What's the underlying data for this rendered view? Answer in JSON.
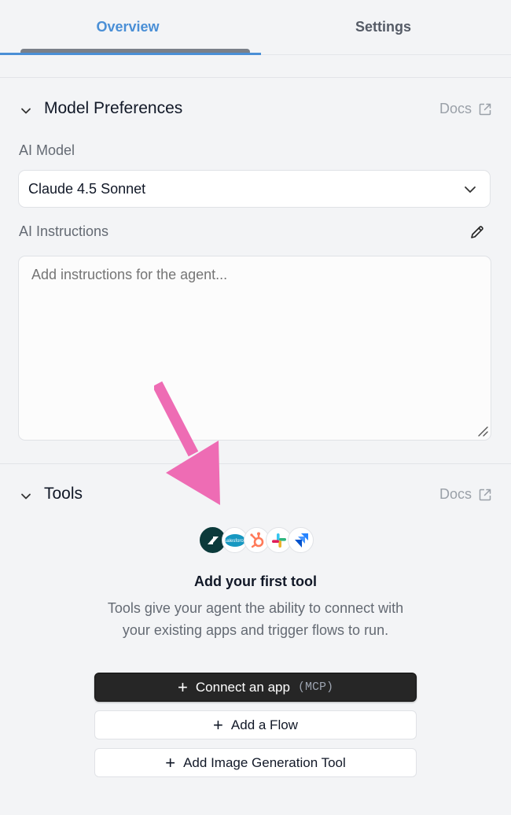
{
  "tabs": {
    "overview": "Overview",
    "settings": "Settings"
  },
  "model_section": {
    "title": "Model Preferences",
    "docs_label": "Docs",
    "ai_model_label": "AI Model",
    "ai_model_value": "Claude 4.5 Sonnet",
    "ai_instructions_label": "AI Instructions",
    "instructions_placeholder": "Add instructions for the agent..."
  },
  "tools_section": {
    "title": "Tools",
    "docs_label": "Docs",
    "logos": [
      "zendesk-logo",
      "salesforce-logo",
      "hubspot-logo",
      "slack-logo",
      "jira-logo"
    ],
    "salesforce_wordmark": "salesforce",
    "empty_title": "Add your first tool",
    "empty_description": "Tools give your agent the ability to connect with your existing apps and trigger flows to run.",
    "connect_app_label": "Connect an app",
    "connect_app_badge": "(MCP)",
    "add_flow_label": "Add a Flow",
    "add_image_tool_label": "Add Image Generation Tool"
  },
  "colors": {
    "accent": "#4a8fd6",
    "annotation_arrow": "#ee6cb4"
  }
}
